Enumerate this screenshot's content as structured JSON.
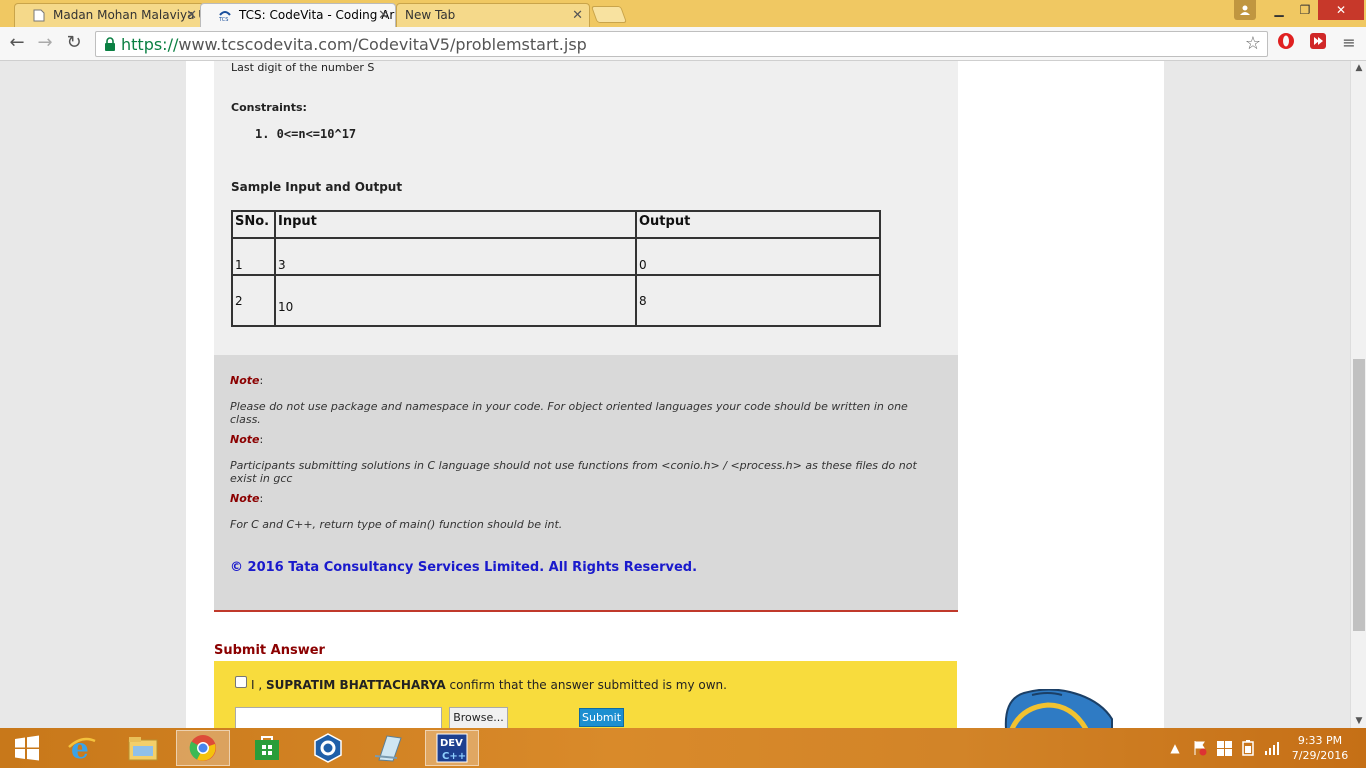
{
  "browser": {
    "tabs": [
      {
        "title": "Madan Mohan Malaviya U",
        "active": false
      },
      {
        "title": "TCS: CodeVita - Coding Ar",
        "active": true
      },
      {
        "title": "New Tab",
        "active": false
      }
    ],
    "url_https": "https://",
    "url_rest": "www.tcscodevita.com/CodevitaV5/problemstart.jsp"
  },
  "problem": {
    "output_desc": "Last digit of the number S",
    "constraints_title": "Constraints:",
    "constraint_1": "1. 0<=n<=10^17",
    "sample_title": "Sample Input and Output",
    "table_headers": [
      "SNo.",
      "Input",
      "Output"
    ],
    "rows": [
      {
        "sno": "1",
        "input": "3",
        "output": "0"
      },
      {
        "sno": "2",
        "input": "10",
        "output": "8"
      }
    ]
  },
  "notes": {
    "label": "Note",
    "note_1": "Please do not use package and namespace in your code. For object oriented languages your code should be written in one class.",
    "note_2": "Participants submitting solutions in C language should not use functions from <conio.h> / <process.h> as these files do not exist in gcc",
    "note_3": "For C and C++, return type of main() function should be int.",
    "copyright": "© 2016 Tata Consultancy Services Limited. All Rights Reserved."
  },
  "submit": {
    "title": "Submit Answer",
    "confirm_prefix": "I ,",
    "user_name": "SUPRATIM BHATTACHARYA",
    "confirm_suffix": "confirm that the answer submitted is my own.",
    "browse_label": "Browse...",
    "submit_label": "Submit"
  },
  "taskbar": {
    "time": "9:33 PM",
    "date": "7/29/2016",
    "dev_label": "DEV"
  }
}
